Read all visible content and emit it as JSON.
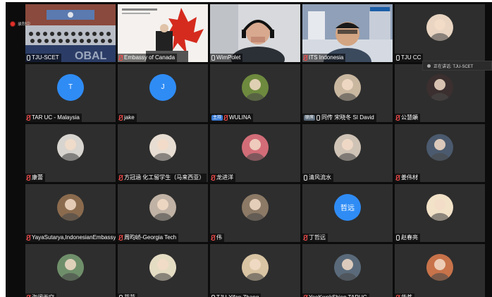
{
  "recording": {
    "label": "录制中"
  },
  "speaking_indicator": {
    "label": "正在讲话: TJU-SCET"
  },
  "tiles": [
    {
      "name": "TJU-SCET",
      "kind": "video",
      "scene": "auditorium",
      "tag": "",
      "muted": false,
      "avatar_color": ""
    },
    {
      "name": "Embassy of Canada",
      "kind": "video",
      "scene": "canada",
      "tag": "",
      "muted": true,
      "avatar_color": ""
    },
    {
      "name": "WimPolet",
      "kind": "video",
      "scene": "headset",
      "tag": "",
      "muted": false,
      "avatar_color": ""
    },
    {
      "name": "ITS Indonesia",
      "kind": "video",
      "scene": "its",
      "tag": "",
      "muted": true,
      "avatar_color": ""
    },
    {
      "name": "TJU CC",
      "kind": "avatar",
      "tag": "",
      "muted": false,
      "avatar_color": "#e9d5c2"
    },
    {
      "name": "TAR UC - Malaysia",
      "kind": "letter",
      "letter": "T",
      "tag": "",
      "muted": true,
      "avatar_color": "#2f8cf5"
    },
    {
      "name": "jake",
      "kind": "letter",
      "letter": "J",
      "tag": "",
      "muted": true,
      "avatar_color": "#2f8cf5"
    },
    {
      "name": "WULINA",
      "kind": "avatar",
      "tag": "主持",
      "muted": true,
      "avatar_color": "#6e8a3e"
    },
    {
      "name": "同传 宋晓冬 SI David",
      "kind": "avatar",
      "tag": "联席",
      "muted": false,
      "avatar_color": "#c9b7a0"
    },
    {
      "name": "公慧頔",
      "kind": "avatar",
      "tag": "",
      "muted": true,
      "avatar_color": "#3b2f2f"
    },
    {
      "name": "康蕾",
      "kind": "avatar",
      "tag": "",
      "muted": true,
      "avatar_color": "#d8d4cf"
    },
    {
      "name": "方冠涵 化工留学生（马来西亚）",
      "kind": "avatar",
      "tag": "",
      "muted": true,
      "avatar_color": "#e8ddd2"
    },
    {
      "name": "龙进洋",
      "kind": "avatar",
      "tag": "",
      "muted": true,
      "avatar_color": "#d26d78"
    },
    {
      "name": "清风流水",
      "kind": "avatar",
      "tag": "",
      "muted": false,
      "avatar_color": "#cfc3b6"
    },
    {
      "name": "姜伟材",
      "kind": "avatar",
      "tag": "",
      "muted": true,
      "avatar_color": "#4b5a6e"
    },
    {
      "name": "YayaSutarya,IndonesianEmbassy",
      "kind": "avatar",
      "tag": "",
      "muted": true,
      "avatar_color": "#8b6b4e"
    },
    {
      "name": "周昀峤-Georgia Tech",
      "kind": "avatar",
      "tag": "",
      "muted": true,
      "avatar_color": "#c0b2a4"
    },
    {
      "name": "伟",
      "kind": "avatar",
      "tag": "",
      "muted": true,
      "avatar_color": "#8c7a66"
    },
    {
      "name": "丁哲远",
      "kind": "letter",
      "letter": "哲远",
      "tag": "",
      "muted": true,
      "avatar_color": "#2f8cf5"
    },
    {
      "name": "赵春亮",
      "kind": "avatar",
      "tag": "",
      "muted": false,
      "avatar_color": "#f2e2c8"
    },
    {
      "name": "海阔天空",
      "kind": "avatar",
      "tag": "",
      "muted": true,
      "avatar_color": "#6f8f6a"
    },
    {
      "name": "花花",
      "kind": "avatar",
      "tag": "",
      "muted": false,
      "avatar_color": "#e5dcc4"
    },
    {
      "name": "TJU-Yifan Zhang",
      "kind": "avatar",
      "tag": "",
      "muted": false,
      "avatar_color": "#d9c5a3"
    },
    {
      "name": "YeoKwokShien TARUC",
      "kind": "avatar",
      "tag": "",
      "muted": true,
      "avatar_color": "#5a6a7a"
    },
    {
      "name": "华茗",
      "kind": "avatar",
      "tag": "",
      "muted": true,
      "avatar_color": "#c8734a"
    }
  ]
}
